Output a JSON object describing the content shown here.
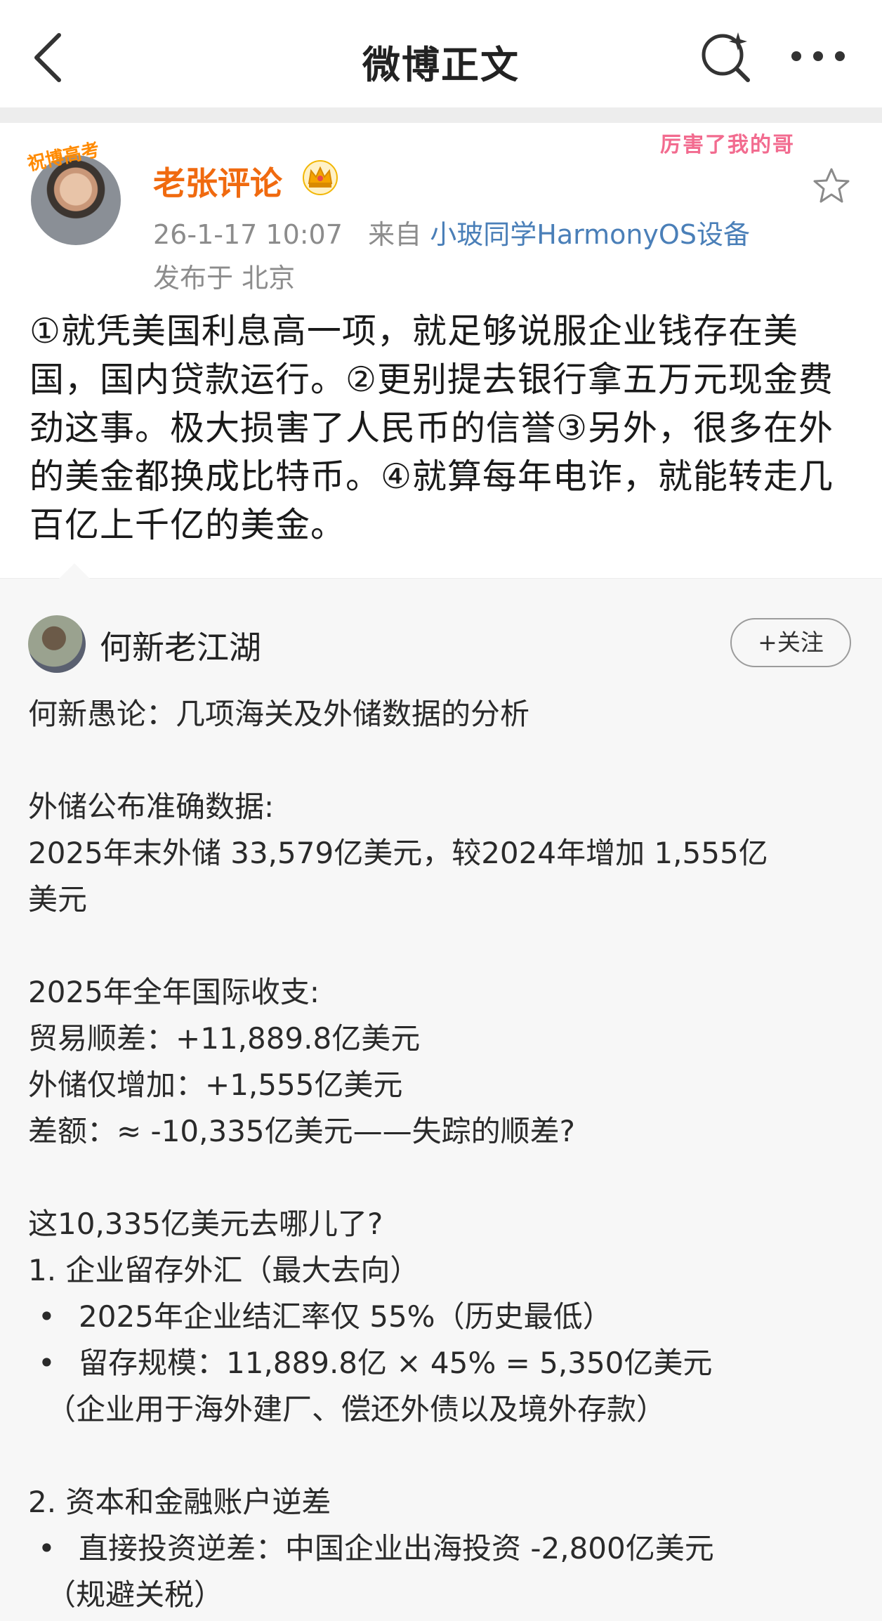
{
  "nav": {
    "title": "微博正文",
    "icons": {
      "back": "back-chevron-icon",
      "search": "search-sparkle-icon",
      "more": "more-dots-icon"
    }
  },
  "post": {
    "author": {
      "name": "老张评论",
      "avatar_badge": "祝博高考",
      "crown": "crown-icon"
    },
    "sticker": "厉害了我的哥",
    "timestamp": "26-1-17 10:07",
    "source_prefix": "来自",
    "source_device": "小玻同学HarmonyOS设备",
    "location": "发布于 北京",
    "text": "①就凭美国利息高一项，就足够说服企业钱存在美国，国内贷款运行。②更别提去银行拿五万元现金费劲这事。极大损害了人民币的信誉③另外，很多在外的美金都换成比特币。④就算每年电诈，就能转走几百亿上千亿的美金。"
  },
  "repost": {
    "author": {
      "name": "何新老江湖"
    },
    "follow_label": "+关注",
    "lines": [
      "何新愚论：几项海关及外储数据的分析",
      "",
      "外储公布准确数据:",
      "2025年末外储 33,579亿美元，较2024年增加 1,555亿",
      "美元",
      "",
      "2025年全年国际收支:",
      "贸易顺差：+11,889.8亿美元",
      "外储仅增加：+1,555亿美元",
      "差额：≈ -10,335亿美元——失踪的顺差?",
      "",
      "这10,335亿美元去哪儿了?",
      "1.  企业留存外汇（最大去向）",
      "2025年企业结汇率仅 55%（历史最低）",
      "留存规模：11,889.8亿 × 45% = 5,350亿美元",
      "（企业用于海外建厂、偿还外债以及境外存款）",
      "",
      "2.  资本和金融账户逆差",
      "直接投资逆差：中国企业出海投资 -2,800亿美元",
      "（规避关税）"
    ]
  }
}
